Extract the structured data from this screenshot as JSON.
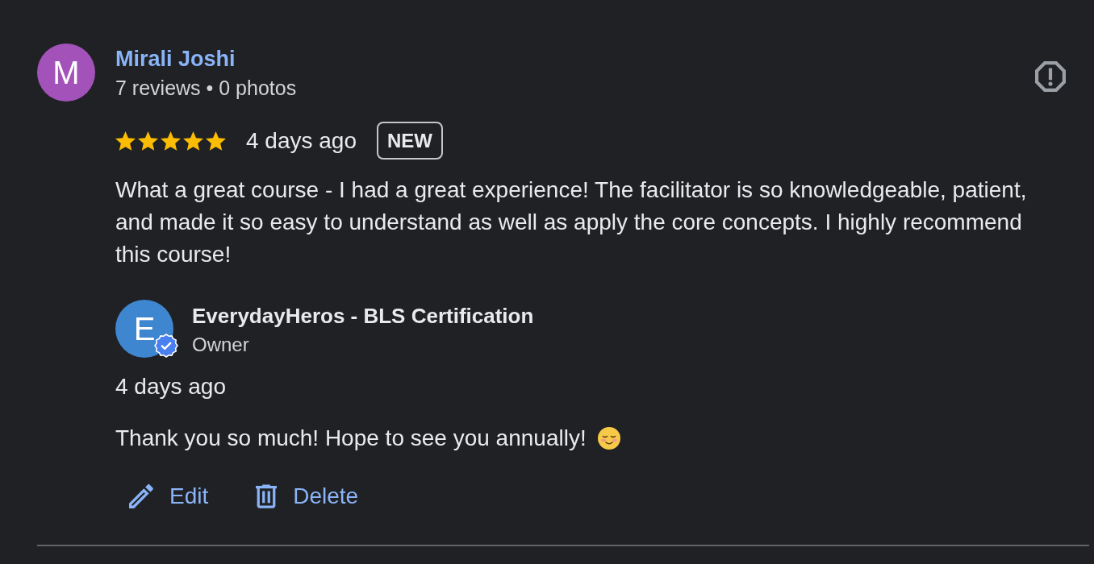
{
  "review": {
    "avatar_letter": "M",
    "reviewer": "Mirali Joshi",
    "reviewer_stats": "7 reviews • 0 photos",
    "stars": 5,
    "date": "4 days ago",
    "badge": "NEW",
    "text": "What a great course - I had a great experience! The facilitator is so knowledgeable, patient, and made it so easy to understand as well as apply the core concepts. I highly recommend this course!"
  },
  "owner_reply": {
    "avatar_letter": "E",
    "verified": true,
    "business": "EverydayHeros - BLS Certification",
    "role": "Owner",
    "date": "4 days ago",
    "text": "Thank you so much! Hope to see you annually!"
  },
  "actions": [
    {
      "kind": "edit",
      "label": "Edit"
    },
    {
      "kind": "delete",
      "label": "Delete"
    }
  ]
}
